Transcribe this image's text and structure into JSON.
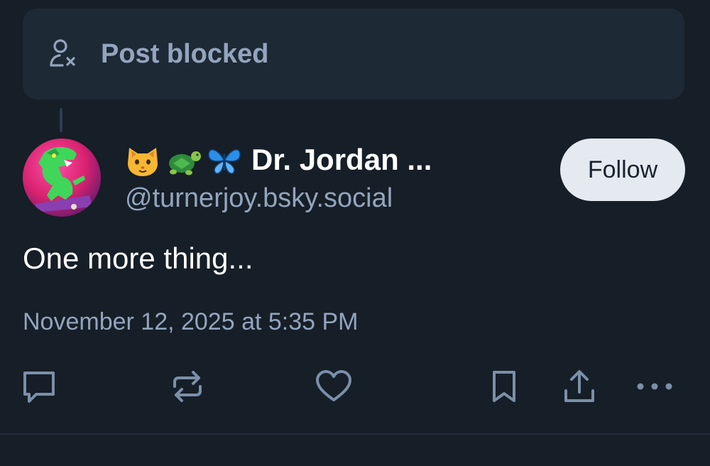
{
  "blocked": {
    "label": "Post blocked",
    "icon": "person-x-icon"
  },
  "post": {
    "author": {
      "emojis": [
        "cat-face",
        "turtle",
        "butterfly"
      ],
      "name": "Dr. Jordan ...",
      "handle": "@turnerjoy.bsky.social"
    },
    "follow_label": "Follow",
    "text": "One more thing...",
    "timestamp": "November 12, 2025 at 5:35 PM"
  },
  "actions": [
    {
      "name": "reply",
      "icon": "speech-bubble-icon"
    },
    {
      "name": "repost",
      "icon": "repost-arrows-icon"
    },
    {
      "name": "like",
      "icon": "heart-icon"
    },
    {
      "name": "bookmark",
      "icon": "bookmark-icon"
    },
    {
      "name": "share",
      "icon": "share-icon"
    },
    {
      "name": "more",
      "icon": "ellipsis-icon"
    }
  ],
  "colors": {
    "background": "#161e27",
    "card": "#1e2936",
    "muted_text": "#93a5bd",
    "icon": "#7b8fa8",
    "follow_button": "#e5eaf1"
  }
}
